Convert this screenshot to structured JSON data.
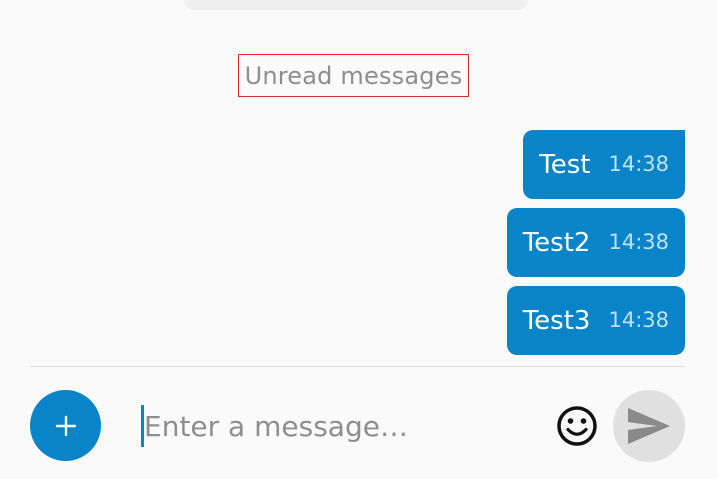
{
  "chat": {
    "unread_label": "Unread messages",
    "messages": [
      {
        "text": "Test",
        "time": "14:38"
      },
      {
        "text": "Test2",
        "time": "14:38"
      },
      {
        "text": "Test3",
        "time": "14:38"
      }
    ]
  },
  "composer": {
    "placeholder": "Enter a message…",
    "attach_icon": "plus-icon",
    "emoji_icon": "smiley-icon",
    "send_icon": "send-icon"
  },
  "colors": {
    "accent": "#0a84c8",
    "background": "#fafafa",
    "unread_border": "#d32f2f",
    "send_button_bg": "#e0e0e0"
  }
}
